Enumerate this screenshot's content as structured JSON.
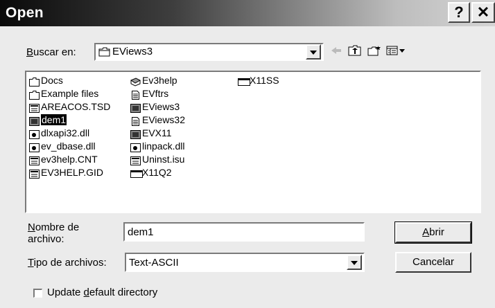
{
  "window": {
    "title": "Open",
    "help_glyph": "?",
    "close_glyph": "✕"
  },
  "lookin": {
    "label_first": "B",
    "label_rest": "uscar en:",
    "value": "EViews3"
  },
  "toolbar": {
    "back_icon": "left-arrow-icon",
    "up_icon": "up-folder-icon",
    "new_folder_icon": "new-folder-icon",
    "view_icon": "view-menu-icon"
  },
  "files": [
    {
      "name": "Docs",
      "icon": "folder-icon"
    },
    {
      "name": "Example files",
      "icon": "folder-icon"
    },
    {
      "name": "AREACOS.TSD",
      "icon": "file-icon"
    },
    {
      "name": "dem1",
      "icon": "app-icon",
      "selected": true
    },
    {
      "name": "dlxapi32.dll",
      "icon": "dll-icon"
    },
    {
      "name": "ev_dbase.dll",
      "icon": "dll-icon"
    },
    {
      "name": "ev3help.CNT",
      "icon": "file-icon"
    },
    {
      "name": "EV3HELP.GID",
      "icon": "file-icon"
    },
    {
      "name": "Ev3help",
      "icon": "help-book-icon"
    },
    {
      "name": "EVftrs",
      "icon": "text-file-icon"
    },
    {
      "name": "EViews3",
      "icon": "app-icon"
    },
    {
      "name": "EViews32",
      "icon": "text-file-icon"
    },
    {
      "name": "EVX11",
      "icon": "app-icon"
    },
    {
      "name": "linpack.dll",
      "icon": "dll-icon"
    },
    {
      "name": "Uninst.isu",
      "icon": "file-icon"
    },
    {
      "name": "X11Q2",
      "icon": "window-icon"
    },
    {
      "name": "X11SS",
      "icon": "window-icon"
    }
  ],
  "filename": {
    "label_first": "N",
    "label_rest": "ombre de",
    "label_line2": "archivo:",
    "value": "dem1"
  },
  "filetype": {
    "label_first": "T",
    "label_rest": "ipo de archivos:",
    "value": "Text-ASCII"
  },
  "buttons": {
    "open_first": "A",
    "open_rest": "brir",
    "cancel": "Cancelar"
  },
  "checkbox": {
    "label_before": "Update ",
    "label_underlined": "d",
    "label_after": "efault directory",
    "checked": false
  }
}
